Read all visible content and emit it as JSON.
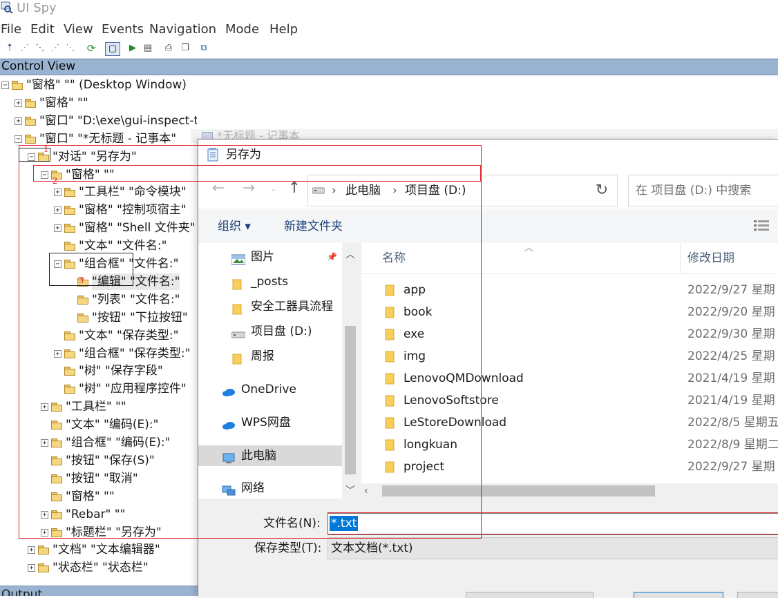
{
  "app": {
    "title": "UI Spy",
    "menu": [
      "File",
      "Edit",
      "View",
      "Events",
      "Navigation",
      "Mode",
      "Help"
    ]
  },
  "control_view": {
    "header": "Control View",
    "tree": [
      {
        "label": "\"窗格\" \"\" (Desktop Window)",
        "toggle": "−"
      },
      {
        "label": "\"窗格\" \"\"",
        "toggle": "+"
      },
      {
        "label": "\"窗口\" \"D:\\exe\\gui-inspect-tool-master\\gui-inspe...\"",
        "toggle": "+"
      },
      {
        "label": "\"窗口\" \"*无标题 - 记事本\"",
        "toggle": "−"
      },
      {
        "label": "\"对话\" \"另存为\"",
        "toggle": "−"
      },
      {
        "label": "\"窗格\" \"\"",
        "toggle": "−"
      },
      {
        "label": "\"工具栏\" \"命令模块\"",
        "toggle": "+"
      },
      {
        "label": "\"窗格\" \"控制项宿主\"",
        "toggle": "+"
      },
      {
        "label": "\"窗格\" \"Shell 文件夹\"",
        "toggle": "+"
      },
      {
        "label": "\"文本\" \"文件名:\"",
        "toggle": ""
      },
      {
        "label": "\"组合框\" \"文件名:\"",
        "toggle": "−"
      },
      {
        "label": "\"编辑\" \"文件名:\"",
        "toggle": ""
      },
      {
        "label": "\"列表\" \"文件名:\"",
        "toggle": ""
      },
      {
        "label": "\"按钮\" \"下拉按钮\"",
        "toggle": ""
      },
      {
        "label": "\"文本\" \"保存类型:\"",
        "toggle": ""
      },
      {
        "label": "\"组合框\" \"保存类型:\"",
        "toggle": "+"
      },
      {
        "label": "\"树\" \"保存字段\"",
        "toggle": ""
      },
      {
        "label": "\"树\" \"应用程序控件\"",
        "toggle": ""
      },
      {
        "label": "\"工具栏\" \"\"",
        "toggle": "+"
      },
      {
        "label": "\"文本\" \"编码(E):\"",
        "toggle": ""
      },
      {
        "label": "\"组合框\" \"编码(E):\"",
        "toggle": "+"
      },
      {
        "label": "\"按钮\" \"保存(S)\"",
        "toggle": ""
      },
      {
        "label": "\"按钮\" \"取消\"",
        "toggle": ""
      },
      {
        "label": "\"窗格\" \"\"",
        "toggle": ""
      },
      {
        "label": "\"Rebar\" \"\"",
        "toggle": "+"
      },
      {
        "label": "\"标题栏\" \"另存为\"",
        "toggle": "+"
      },
      {
        "label": "\"文档\" \"文本编辑器\"",
        "toggle": "+"
      },
      {
        "label": "\"状态栏\" \"状态栏\"",
        "toggle": "+"
      }
    ],
    "output_header": "Output"
  },
  "notepad": {
    "title": "*无标题 - 记事本"
  },
  "annotations": {
    "n1": "1",
    "n2": "2",
    "n3": "3"
  },
  "dialog": {
    "title": "另存为",
    "breadcrumb": [
      "此电脑",
      "项目盘 (D:)"
    ],
    "search_placeholder": "在 项目盘 (D:) 中搜索",
    "organize": "组织 ▾",
    "new_folder": "新建文件夹",
    "nav_items": [
      {
        "label": "图片",
        "icon": "picture-icon"
      },
      {
        "label": "_posts",
        "icon": "folder-icon"
      },
      {
        "label": "安全工器具流程",
        "icon": "folder-icon"
      },
      {
        "label": "项目盘 (D:)",
        "icon": "drive-icon"
      },
      {
        "label": "周报",
        "icon": "folder-icon"
      },
      {
        "label": "OneDrive",
        "icon": "cloud-icon"
      },
      {
        "label": "WPS网盘",
        "icon": "cloud-icon"
      },
      {
        "label": "此电脑",
        "icon": "computer-icon"
      },
      {
        "label": "网络",
        "icon": "network-icon"
      }
    ],
    "columns": {
      "name": "名称",
      "modified": "修改日期"
    },
    "files": [
      {
        "name": "app",
        "date": "2022/9/27 星期"
      },
      {
        "name": "book",
        "date": "2022/9/20 星期"
      },
      {
        "name": "exe",
        "date": "2022/9/30 星期"
      },
      {
        "name": "img",
        "date": "2022/4/25 星期"
      },
      {
        "name": "LenovoQMDownload",
        "date": "2021/4/19 星期"
      },
      {
        "name": "LenovoSoftstore",
        "date": "2021/4/19 星期"
      },
      {
        "name": "LeStoreDownload",
        "date": "2022/8/5 星期五"
      },
      {
        "name": "longkuan",
        "date": "2022/8/9 星期二"
      },
      {
        "name": "project",
        "date": "2022/9/27 星期"
      }
    ],
    "filename_label": "文件名(N):",
    "filename_value": "*.txt",
    "filetype_label": "保存类型(T):",
    "filetype_value": "文本文档(*.txt)"
  },
  "colors": {
    "header_bg": "#99b4d1",
    "annotation_red": "#e0202a",
    "selection_blue": "#0078d7"
  }
}
